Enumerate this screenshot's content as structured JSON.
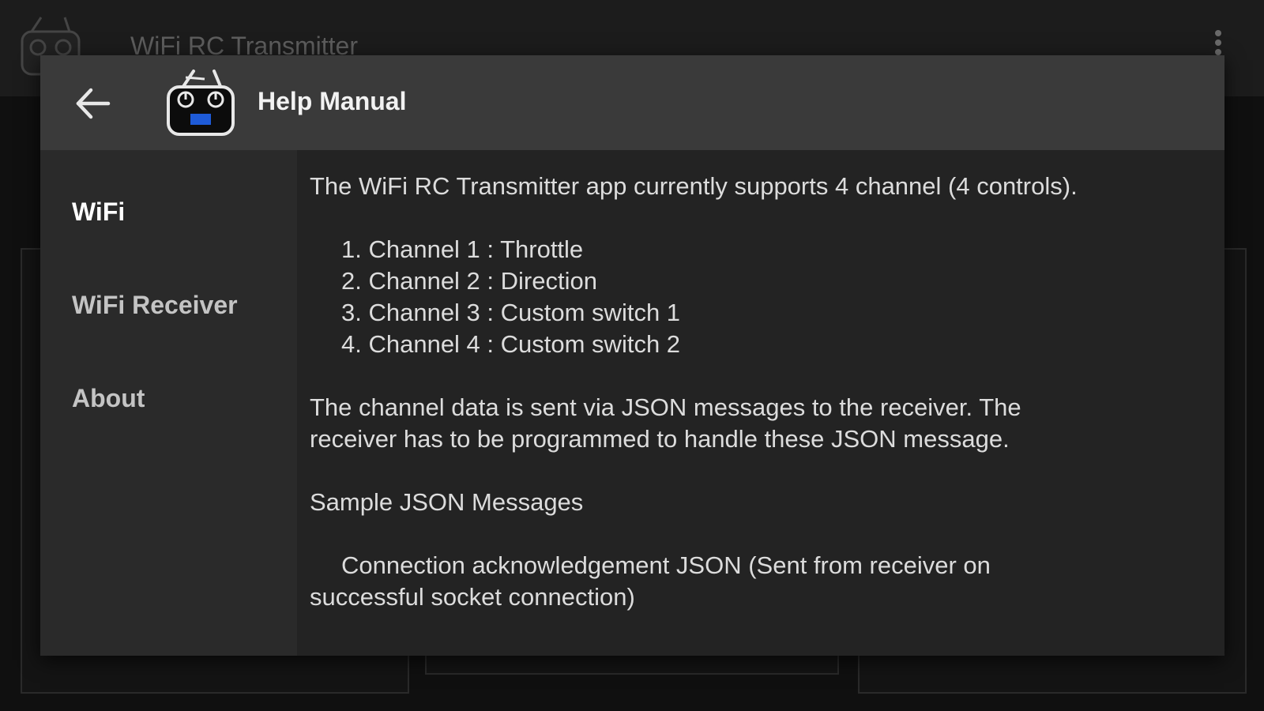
{
  "background": {
    "app_title": "WiFi RC Transmitter",
    "menu_icon": "overflow-menu-icon",
    "logo_icon": "rc-transmitter-icon"
  },
  "dialog": {
    "title": "Help Manual",
    "back_icon": "back-arrow-icon",
    "logo_icon": "rc-transmitter-icon",
    "accent_color": "#1e5bd8"
  },
  "sidebar": {
    "items": [
      {
        "label": "WiFi",
        "active": true
      },
      {
        "label": "WiFi Receiver",
        "active": false
      },
      {
        "label": "About",
        "active": false
      }
    ]
  },
  "content": {
    "intro": "The WiFi RC Transmitter app currently supports 4 channel (4 controls).",
    "channels": [
      "1. Channel 1 : Throttle",
      "2. Channel 2 : Direction",
      "3. Channel 3 : Custom switch 1",
      "4. Channel 4 : Custom switch 2"
    ],
    "json_paragraph_line1": "The channel data is sent via JSON messages to the receiver. The",
    "json_paragraph_line2": "receiver has to be programmed to handle these JSON message.",
    "sample_heading": "Sample JSON Messages",
    "ack_line1": "Connection acknowledgement JSON (Sent from receiver on",
    "ack_line2": "successful socket connection)"
  }
}
